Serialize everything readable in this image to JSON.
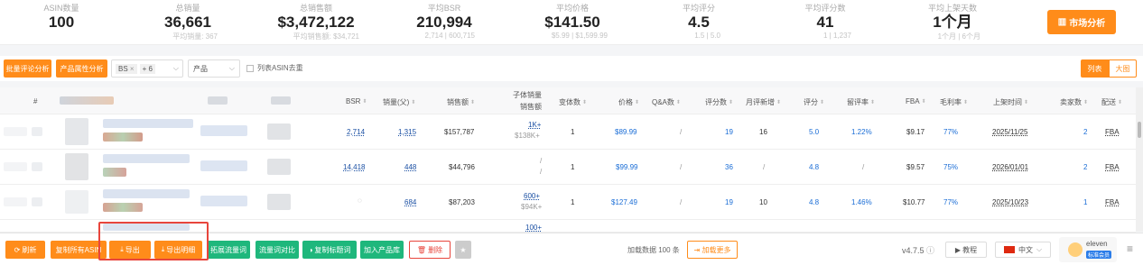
{
  "stats": [
    {
      "label": "ASIN数量",
      "value": "100",
      "sub": ""
    },
    {
      "label": "总销量",
      "value": "36,661",
      "sub": "平均销量: 367"
    },
    {
      "label": "总销售额",
      "value": "$3,472,122",
      "sub": "平均销售额: $34,721"
    },
    {
      "label": "平均BSR",
      "value": "210,994",
      "sub": "2,714 | 600,715"
    },
    {
      "label": "平均价格",
      "value": "$141.50",
      "sub": "$5.99 | $1,599.99"
    },
    {
      "label": "平均评分",
      "value": "4.5",
      "sub": "1.5 | 5.0"
    },
    {
      "label": "平均评分数",
      "value": "41",
      "sub": "1 | 1,237"
    },
    {
      "label": "平均上架天数",
      "value": "1个月",
      "sub": "1个月 | 6个月"
    }
  ],
  "market_button": "市场分析",
  "toolbar": {
    "batch_review": "批量评论分析",
    "attr_analysis": "产品属性分析",
    "chip": "BS",
    "chip_more": "+ 6",
    "select": "产品",
    "dedupe": "列表ASIN去重",
    "view_list": "列表",
    "view_grid": "大图"
  },
  "columns": [
    "#",
    "BSR",
    "销量(父)",
    "销售额",
    "子体销量",
    "销售额",
    "变体数",
    "价格",
    "Q&A数",
    "评分数",
    "月评新增",
    "评分",
    "留评率",
    "FBA",
    "毛利率",
    "上架时间",
    "卖家数",
    "配送"
  ],
  "rows": [
    {
      "bsr": "2,714",
      "sales": "1,315",
      "revenue": "$157,787",
      "child_sales": "1K+",
      "child_rev": "$138K+",
      "variants": "1",
      "price": "$89.99",
      "qa": "/",
      "ratings": "19",
      "monthly": "16",
      "rating": "5.0",
      "review_rate": "1.22%",
      "fba": "$9.17",
      "margin": "77%",
      "date": "2025/11/25",
      "sellers": "2",
      "ship": "FBA"
    },
    {
      "bsr": "14,418",
      "sales": "448",
      "revenue": "$44,796",
      "child_sales": "/",
      "child_rev": "/",
      "variants": "1",
      "price": "$99.99",
      "qa": "/",
      "ratings": "36",
      "monthly": "/",
      "rating": "4.8",
      "review_rate": "/",
      "fba": "$9.57",
      "margin": "75%",
      "date": "2026/01/01",
      "sellers": "2",
      "ship": "FBA"
    },
    {
      "bsr": "",
      "sales": "684",
      "revenue": "$87,203",
      "child_sales": "600+",
      "child_rev": "$94K+",
      "variants": "1",
      "price": "$127.49",
      "qa": "/",
      "ratings": "19",
      "monthly": "10",
      "rating": "4.8",
      "review_rate": "1.46%",
      "fba": "$10.77",
      "margin": "77%",
      "date": "2025/10/23",
      "sellers": "1",
      "ship": "FBA"
    }
  ],
  "partial_row": {
    "child_sales": "100+"
  },
  "bottom": {
    "refresh": "刷新",
    "copy_asin": "复制所有ASIN",
    "export": "导出",
    "export_detail": "导出明细",
    "expand_kw": "拓展流量词",
    "compare_kw": "流量词对比",
    "copy_title": "复制标题词",
    "add_lib": "加入产品库",
    "delete": "删除",
    "load_info": "加载数据 100 条",
    "load_more": "加载更多",
    "version": "v4.7.5",
    "tutorial": "教程",
    "language": "中文",
    "user": "eleven",
    "member": "标准会员"
  }
}
